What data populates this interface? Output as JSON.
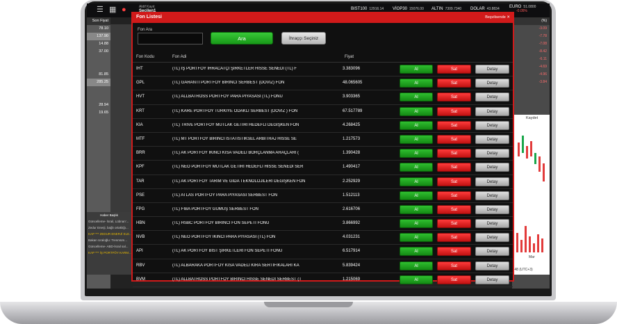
{
  "topbar": {
    "user_label": "Aktif Kayıt",
    "user_name": "Seçilen1",
    "tickers": [
      {
        "name": "BIST100",
        "value": "12916.14"
      },
      {
        "name": "VİOP30",
        "value": "15076.00"
      },
      {
        "name": "ALTIN",
        "value": "7309.7340"
      },
      {
        "name": "DOLAR",
        "value": "43.8834"
      },
      {
        "name": "EURO",
        "value": "51.0800",
        "change": "-0.05%"
      }
    ]
  },
  "left_panel": {
    "header": "Son Fiyat",
    "prices": [
      "78.10",
      "137.90",
      "14.88",
      "37.00",
      "",
      "",
      "81.85",
      "285.25",
      "",
      "",
      "28.94",
      "19.65"
    ]
  },
  "symbol_panel": {
    "header": "Fon Listesi",
    "search_label": "Fon Ara",
    "col_label": "Fon Kodu",
    "codes": [
      "IHT",
      "GPL",
      "HVT",
      "KRT",
      "KIA",
      "MTF",
      "BRR",
      "KPF",
      "TAR",
      "PSE",
      "FPG",
      "HBN",
      "NVB",
      "AJN",
      "RBV",
      "BVM"
    ]
  },
  "right_panel": {
    "header": "(%)",
    "changes": [
      "-3.09",
      "-7.78",
      "-7.08",
      "-8.42",
      "-6.11",
      "-4.69",
      "-4.96",
      "-3.84"
    ],
    "kaydet_label": "Kaydet",
    "time_label": ":48 (UTC+3)",
    "axis_label": "Mar"
  },
  "news": {
    "title": "Haber Başlık",
    "items": [
      "Güncelleme- İsrail, Lübnan'...",
      "Zedur Enerji, bağlı ortaklığı...",
      "KAP *** ZEDUR ENERJİ ELE...",
      "Bakan Uraloğlu: Trenmüm...",
      "Güncelleme- ABD-İsrail sal...",
      "KAP *** İŞ PORTFÖY KARM..."
    ]
  },
  "modal": {
    "title": "Fon Listesi",
    "close_label": "Beşvilsende",
    "search_label": "Fon Ara",
    "search_value": "",
    "search_placeholder": "",
    "search_button": "Ara",
    "issuer_button": "İhraççı Seçiniz",
    "columns": {
      "code": "Fon Kodu",
      "name": "Fon Adi",
      "price": "Fiyat"
    },
    "buy_label": "Al",
    "sell_label": "Sat",
    "detail_label": "Detay",
    "rows": [
      {
        "code": "IHT",
        "name": "(TL) İŞ PORTFÖY İHRACATÇI ŞİRKETLER HİSSE SENEDİ (TL) F",
        "price": "3.383096"
      },
      {
        "code": "GPL",
        "name": "(TL) GARANTİ PORTFÖY BİRİNCİ SERBEST (DÖVİZ) FON",
        "price": "48.065605"
      },
      {
        "code": "HVT",
        "name": "(TL) ALLBATROSS PORTFÖY PARA PİYASASI (TL) FONU",
        "price": "3.903365"
      },
      {
        "code": "KRT",
        "name": "(TL) KARE PORTFÖY TÜRKİYE ODAKLI SERBEST (DÖVİZ ) FON",
        "price": "67.517789"
      },
      {
        "code": "KIA",
        "name": "(TL) TRIVE PORTFÖY MUTLAK GETİRİ HEDEFLİ DEĞİŞKEN FON",
        "price": "4.268425"
      },
      {
        "code": "MTF",
        "name": "(TL) MT PORTFÖY BİRİNCİ İSTATİSTİKSEL ARBİTRAJ HİSSE SE",
        "price": "1.217573"
      },
      {
        "code": "BRR",
        "name": "(TL) AK PORTFÖY İKİNCİ KISA VADELİ BORÇLANMA ARAÇLARI (",
        "price": "1.390428"
      },
      {
        "code": "KPF",
        "name": "(TL) NEO PORTFÖY MUTLAK GETİRİ HEDEFLİ HİSSE SENEDİ SER",
        "price": "1.490417"
      },
      {
        "code": "TAR",
        "name": "(TL) AK PORTFÖY TARIM VE GIDA TEKNOLOJİLERİ DEĞİŞKEN FON",
        "price": "2.252929"
      },
      {
        "code": "PSE",
        "name": "(TL) ATLAS PORTFÖY PARA PİYASASI SERBEST FON",
        "price": "1.512113"
      },
      {
        "code": "FPG",
        "name": "(TL) FİBA PORTFÖY GÜMÜŞ SERBEST FON",
        "price": "2.616706"
      },
      {
        "code": "HBN",
        "name": "(TL) HSBC PORTFÖY BİRİNCİ FON SEPETİ FONU",
        "price": "3.866992"
      },
      {
        "code": "NVB",
        "name": "(TL) NEO PORTFÖY İKİNCİ PARA PİYASASI (TL) FON",
        "price": "4.031231"
      },
      {
        "code": "API",
        "name": "(TL) AK PORTFÖY BIST ŞİRKETLERİ FON SEPETİ FONU",
        "price": "6.517914"
      },
      {
        "code": "RBV",
        "name": "(TL) ALBARAKA PORTFÖY KISA VADELİ KİRA SERTİFİKALARI KA",
        "price": "5.839424"
      },
      {
        "code": "BVM",
        "name": "(TL) ALLBATROSS PORTFÖY BİRİNCİ HİSSE SENEDİ SERBEST (T",
        "price": "1.215069"
      }
    ]
  },
  "colors": {
    "accent_red": "#d11a1a",
    "buy_green": "#1fa51f",
    "sell_red": "#e02020"
  }
}
